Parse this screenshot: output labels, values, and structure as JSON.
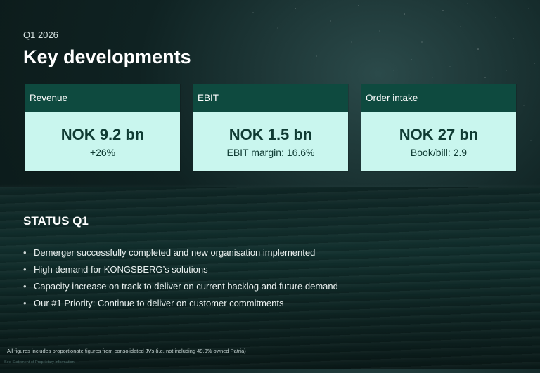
{
  "header": {
    "quarter_label": "Q1 2026",
    "title": "Key developments"
  },
  "kpi_cards": [
    {
      "label": "Revenue",
      "value": "NOK 9.2 bn",
      "sub": "+26%"
    },
    {
      "label": "EBIT",
      "value": "NOK 1.5 bn",
      "sub": "EBIT margin: 16.6%"
    },
    {
      "label": "Order intake",
      "value": "NOK 27 bn",
      "sub": "Book/bill: 2.9"
    }
  ],
  "status": {
    "heading": "STATUS Q1",
    "bullets": [
      "Demerger successfully completed and new organisation implemented",
      "High demand for KONGSBERG’s solutions",
      "Capacity increase on track to deliver on current backlog and future demand",
      "Our #1 Priority: Continue to deliver on customer commitments"
    ]
  },
  "footnote": "All figures includes proportionate figures from consolidated JVs (i.e. not including 49.9% owned Patria)",
  "confidential_note": "See Statement of Proprietary information",
  "colors": {
    "card_header": "#0e4a3f",
    "card_body": "#c9f6ee",
    "card_text": "#0f3b33",
    "background": "#0f2222"
  }
}
